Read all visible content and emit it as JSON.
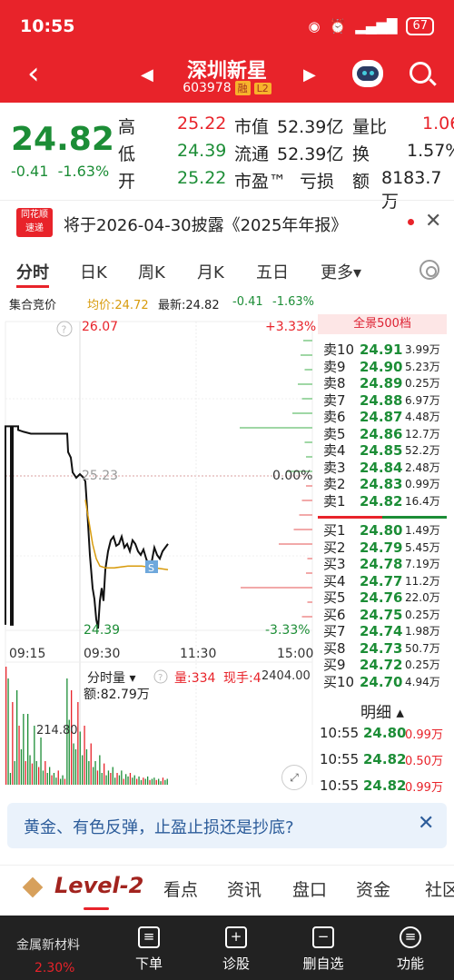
{
  "status": {
    "time": "10:55",
    "battery": "67"
  },
  "stock": {
    "name": "深圳新星",
    "code": "603978",
    "tag1": "融",
    "tag2": "L2"
  },
  "quote": {
    "price": "24.82",
    "change": "-0.41",
    "change_pct": "-1.63%",
    "high_label": "高",
    "high": "25.22",
    "low_label": "低",
    "low": "24.39",
    "open_label": "开",
    "open": "25.22",
    "mktcap_label": "市值",
    "mktcap": "52.39亿",
    "float_label": "流通",
    "float": "52.39亿",
    "pe_label": "市盈™",
    "pe": "亏损",
    "vr_label": "量比",
    "vr": "1.06",
    "turn_label": "换",
    "turn": "1.57%",
    "amt_label": "额",
    "amt": "8183.7万"
  },
  "notice": {
    "logo1": "同花顺",
    "logo2": "速递",
    "text": "将于2026-04-30披露《2025年年报》"
  },
  "tabs": [
    "分时",
    "日K",
    "周K",
    "月K",
    "五日",
    "更多▾"
  ],
  "infobar": {
    "auction": "集合竞价",
    "avg": "均价:24.72",
    "latest": "最新:24.82",
    "chg": "-0.41",
    "pct": "-1.63%"
  },
  "chart_labels": {
    "top_price": "26.07",
    "top_pct": "+3.33%",
    "mid_price": "25.23",
    "mid_pct": "0.00%",
    "low_price": "24.39",
    "bot_pct": "-3.33%",
    "t1": "09:15",
    "t2": "09:30",
    "t3": "11:30",
    "t4": "15:00",
    "vol_label": "分时量 ▾",
    "vol_amt": "额:82.79万",
    "vol_now": "量:334",
    "hand": "现手:4",
    "vol_max": "2404.00",
    "vol_mark": "214.80",
    "s_badge": "S"
  },
  "chart_data": {
    "type": "line",
    "ylim": [
      24.39,
      26.07
    ],
    "base": 25.23,
    "price_series": [
      [
        0,
        24.42
      ],
      [
        0,
        25.5
      ],
      [
        6,
        25.5
      ],
      [
        6,
        24.42
      ],
      [
        8,
        24.42
      ],
      [
        8,
        25.5
      ],
      [
        14,
        25.5
      ],
      [
        14,
        25.48
      ],
      [
        20,
        25.47
      ],
      [
        28,
        25.46
      ],
      [
        40,
        25.46
      ],
      [
        55,
        25.46
      ],
      [
        64,
        25.46
      ],
      [
        68,
        25.46
      ],
      [
        69,
        25.36
      ],
      [
        72,
        25.33
      ],
      [
        74,
        25.25
      ],
      [
        78,
        25.22
      ],
      [
        82,
        25.24
      ],
      [
        86,
        25.22
      ],
      [
        88,
        25.2
      ],
      [
        90,
        25.05
      ],
      [
        93,
        24.8
      ],
      [
        96,
        24.62
      ],
      [
        98,
        24.56
      ],
      [
        100,
        24.45
      ],
      [
        102,
        24.4
      ],
      [
        104,
        24.55
      ],
      [
        106,
        24.62
      ],
      [
        108,
        24.55
      ],
      [
        110,
        24.72
      ],
      [
        113,
        24.82
      ],
      [
        116,
        24.88
      ],
      [
        119,
        24.9
      ],
      [
        122,
        24.85
      ],
      [
        125,
        24.86
      ],
      [
        128,
        24.9
      ],
      [
        131,
        24.84
      ],
      [
        134,
        24.86
      ],
      [
        137,
        24.82
      ],
      [
        140,
        24.88
      ],
      [
        143,
        24.86
      ],
      [
        146,
        24.82
      ],
      [
        149,
        24.8
      ],
      [
        152,
        24.83
      ],
      [
        155,
        24.78
      ],
      [
        158,
        24.74
      ],
      [
        161,
        24.76
      ],
      [
        164,
        24.84
      ],
      [
        167,
        24.8
      ],
      [
        170,
        24.78
      ],
      [
        173,
        24.82
      ],
      [
        176,
        24.84
      ],
      [
        179,
        24.86
      ]
    ],
    "avg_series": [
      [
        88,
        25.1
      ],
      [
        92,
        24.98
      ],
      [
        96,
        24.86
      ],
      [
        100,
        24.78
      ],
      [
        104,
        24.74
      ],
      [
        110,
        24.73
      ],
      [
        120,
        24.73
      ],
      [
        135,
        24.74
      ],
      [
        150,
        24.74
      ],
      [
        165,
        24.73
      ],
      [
        179,
        24.72
      ]
    ],
    "volume_bars": [
      1.0,
      0.9,
      0.1,
      0.7,
      0.2,
      0.8,
      0.5,
      0.3,
      0.6,
      0.2,
      0.6,
      0.25,
      0.18,
      0.5,
      0.2,
      0.15,
      0.4,
      0.12,
      0.2,
      0.1,
      0.15,
      0.08,
      0.1,
      0.06,
      0.12,
      0.05,
      0.08,
      0.05,
      0.9,
      0.55,
      0.8,
      0.35,
      0.3,
      0.7,
      0.45,
      0.25,
      0.5,
      0.3,
      0.2,
      0.35,
      0.15,
      0.2,
      0.12,
      0.25,
      0.1,
      0.18,
      0.08,
      0.12,
      0.1,
      0.15,
      0.06,
      0.1,
      0.08,
      0.12,
      0.05,
      0.09,
      0.07,
      0.1,
      0.06,
      0.08,
      0.05,
      0.07,
      0.04,
      0.06,
      0.05,
      0.07,
      0.04,
      0.05,
      0.06,
      0.04,
      0.05,
      0.03,
      0.06,
      0.04,
      0.05
    ],
    "colors": {
      "price": "#2a6fe0",
      "avg": "#d89b0c",
      "up": "#e8232a",
      "down": "#1c8d36"
    }
  },
  "orderbook": {
    "header": "全景500档",
    "asks": [
      {
        "label": "卖10",
        "price": "24.91",
        "vol": "3.99万"
      },
      {
        "label": "卖9",
        "price": "24.90",
        "vol": "5.23万"
      },
      {
        "label": "卖8",
        "price": "24.89",
        "vol": "0.25万"
      },
      {
        "label": "卖7",
        "price": "24.88",
        "vol": "6.97万"
      },
      {
        "label": "卖6",
        "price": "24.87",
        "vol": "4.48万"
      },
      {
        "label": "卖5",
        "price": "24.86",
        "vol": "12.7万"
      },
      {
        "label": "卖4",
        "price": "24.85",
        "vol": "52.2万"
      },
      {
        "label": "卖3",
        "price": "24.84",
        "vol": "2.48万"
      },
      {
        "label": "卖2",
        "price": "24.83",
        "vol": "0.99万"
      },
      {
        "label": "卖1",
        "price": "24.82",
        "vol": "16.4万"
      }
    ],
    "bids": [
      {
        "label": "买1",
        "price": "24.80",
        "vol": "1.49万"
      },
      {
        "label": "买2",
        "price": "24.79",
        "vol": "5.45万"
      },
      {
        "label": "买3",
        "price": "24.78",
        "vol": "7.19万"
      },
      {
        "label": "买4",
        "price": "24.77",
        "vol": "11.2万"
      },
      {
        "label": "买5",
        "price": "24.76",
        "vol": "22.0万"
      },
      {
        "label": "买6",
        "price": "24.75",
        "vol": "0.25万"
      },
      {
        "label": "买7",
        "price": "24.74",
        "vol": "1.98万"
      },
      {
        "label": "买8",
        "price": "24.73",
        "vol": "50.7万"
      },
      {
        "label": "买9",
        "price": "24.72",
        "vol": "0.25万"
      },
      {
        "label": "买10",
        "price": "24.70",
        "vol": "4.94万"
      }
    ],
    "detail_title": "明细 ▴",
    "ticks": [
      {
        "time": "10:55",
        "price": "24.80",
        "vol": "0.99万"
      },
      {
        "time": "10:55",
        "price": "24.82",
        "vol": "0.50万"
      },
      {
        "time": "10:55",
        "price": "24.82",
        "vol": "0.99万"
      }
    ]
  },
  "banner": {
    "text": "黄金、有色反弹，止盈止损还是抄底?",
    "close": "✕"
  },
  "bottom_tabs": {
    "level": "Level-2",
    "t1": "看点",
    "t2": "资讯",
    "t3": "盘口",
    "t4": "资金",
    "t5": "社区"
  },
  "nav": {
    "sector": "金属新材料",
    "sector_pct": "2.30%",
    "b1": "下单",
    "b2": "诊股",
    "b3": "删自选",
    "b4": "功能"
  }
}
